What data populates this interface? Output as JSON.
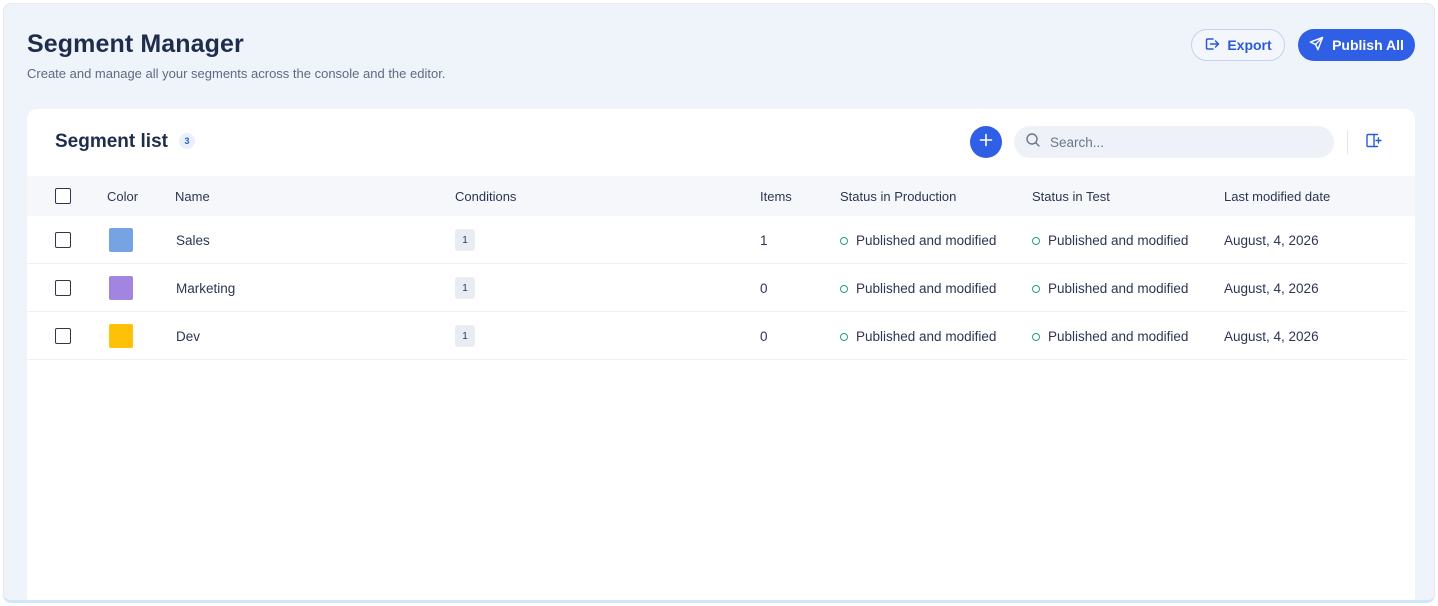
{
  "header": {
    "title": "Segment Manager",
    "subtitle": "Create and manage all your segments across the console and the editor.",
    "export_label": "Export",
    "publish_label": "Publish All"
  },
  "segment_list": {
    "title": "Segment list",
    "count": "3",
    "search_placeholder": "Search..."
  },
  "table": {
    "columns": {
      "color": "Color",
      "name": "Name",
      "conditions": "Conditions",
      "items": "Items",
      "status_production": "Status in Production",
      "status_test": "Status in Test",
      "last_modified": "Last modified date"
    },
    "rows": [
      {
        "color": "#75a3e3",
        "name": "Sales",
        "conditions": "1",
        "items": "1",
        "status_production": "Published and modified",
        "status_test": "Published and modified",
        "last_modified": "August, 4, 2026"
      },
      {
        "color": "#a185e0",
        "name": "Marketing",
        "conditions": "1",
        "items": "0",
        "status_production": "Published and modified",
        "status_test": "Published and modified",
        "last_modified": "August, 4, 2026"
      },
      {
        "color": "#ffc107",
        "name": "Dev",
        "conditions": "1",
        "items": "0",
        "status_production": "Published and modified",
        "status_test": "Published and modified",
        "last_modified": "August, 4, 2026"
      }
    ]
  },
  "colors": {
    "accent": "#2f5fe5",
    "status_dot": "#21a07d"
  },
  "icons": {
    "export": "export-icon",
    "publish": "send-icon",
    "add": "plus-icon",
    "search": "search-icon",
    "columns": "add-column-icon"
  }
}
